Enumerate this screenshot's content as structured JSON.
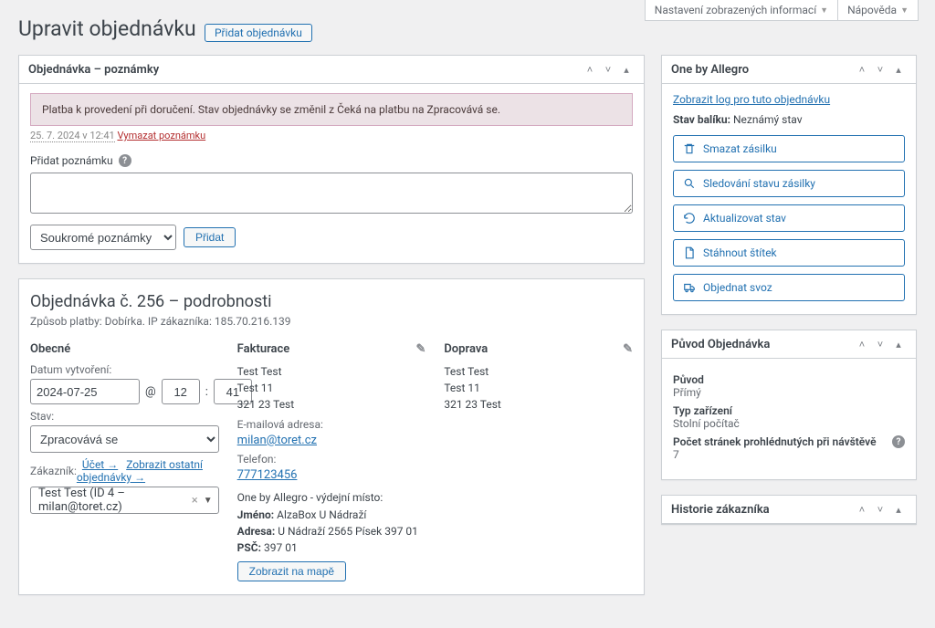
{
  "screenOptions": {
    "settings": "Nastavení zobrazených informací",
    "help": "Nápověda"
  },
  "pageTitle": "Upravit objednávku",
  "addOrder": "Přidat objednávku",
  "notesBox": {
    "title": "Objednávka – poznámky",
    "noticeText": "Platba k provedení při doručení. Stav objednávky se změnil z Čeká na platbu na Zpracovává se.",
    "timestamp": "25. 7. 2024 v 12:41",
    "deleteNote": "Vymazat poznámku",
    "addNoteLabel": "Přidat poznámku",
    "noteType": "Soukromé poznámky",
    "addBtn": "Přidat"
  },
  "detailsBox": {
    "title": "Objednávka č. 256 – podrobnosti",
    "subtitle": "Způsob platby: Dobírka. IP zákazníka: 185.70.216.139",
    "general": {
      "heading": "Obecné",
      "dateLabel": "Datum vytvoření:",
      "date": "2024-07-25",
      "hour": "12",
      "min": "41",
      "statusLabel": "Stav:",
      "status": "Zpracovává se",
      "customerLabel": "Zákazník:",
      "profileLink": "Účet →",
      "otherOrdersLink": "Zobrazit ostatní objednávky →",
      "customer": "Test Test (ID 4 – milan@toret.cz)"
    },
    "billing": {
      "heading": "Fakturace",
      "name": "Test Test",
      "line1": "Test 11",
      "line2": "321 23 Test",
      "emailLabel": "E-mailová adresa:",
      "email": "milan@toret.cz",
      "phoneLabel": "Telefon:",
      "phone": "777123456",
      "pickupHeading": "One by Allegro - výdejní místo:",
      "pickupNameLabel": "Jméno:",
      "pickupName": "AlzaBox U Nádraží",
      "pickupAddrLabel": "Adresa:",
      "pickupAddr": "U Nádraží 2565 Písek 397 01",
      "pickupZipLabel": "PSČ:",
      "pickupZip": "397 01",
      "mapBtn": "Zobrazit na mapě"
    },
    "shipping": {
      "heading": "Doprava",
      "name": "Test Test",
      "line1": "Test 11",
      "line2": "321 23 Test"
    }
  },
  "allegroBox": {
    "title": "One by Allegro",
    "logLink": "Zobrazit log pro tuto objednávku",
    "pkgLabel": "Stav balíku:",
    "pkgValue": "Neznámý stav",
    "actions": {
      "delete": "Smazat zásilku",
      "track": "Sledování stavu zásilky",
      "refresh": "Aktualizovat stav",
      "label": "Stáhnout štítek",
      "pickup": "Objednat svoz"
    }
  },
  "originBox": {
    "title": "Původ Objednávka",
    "originLabel": "Původ",
    "originValue": "Přímý",
    "deviceLabel": "Typ zařízení",
    "deviceValue": "Stolní počítač",
    "pagesLabel": "Počet stránek prohlédnutých při návštěvě",
    "pagesValue": "7"
  },
  "historyBox": {
    "title": "Historie zákazníka"
  }
}
